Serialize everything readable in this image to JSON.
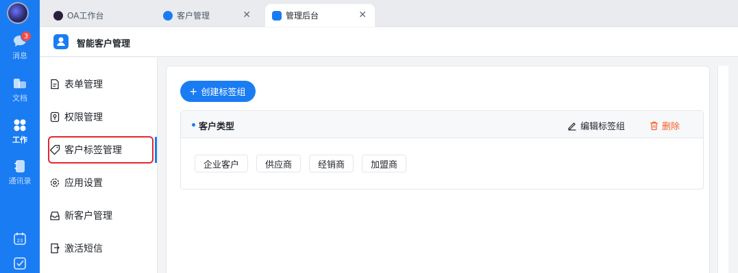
{
  "rail": {
    "items": [
      {
        "label": "消息",
        "icon": "chat-bubble-icon",
        "badge": "3"
      },
      {
        "label": "文档",
        "icon": "folder-icon"
      },
      {
        "label": "工作",
        "icon": "apps-grid-icon",
        "active": true
      },
      {
        "label": "通讯录",
        "icon": "contacts-book-icon"
      }
    ],
    "bottom_icons": [
      "calendar-icon",
      "todo-check-icon"
    ],
    "calendar_day": "23"
  },
  "tabs": [
    {
      "label": "OA工作台",
      "icon": "oa-logo-icon",
      "closable": false
    },
    {
      "label": "客户管理",
      "icon": "customer-app-icon",
      "closable": true
    },
    {
      "label": "管理后台",
      "icon": "admin-app-icon",
      "closable": true,
      "active": true
    }
  ],
  "app": {
    "title": "智能客户管理",
    "icon": "smart-customer-icon"
  },
  "menu": {
    "items": [
      {
        "label": "表单管理",
        "icon": "form-doc-icon"
      },
      {
        "label": "权限管理",
        "icon": "permission-key-icon"
      },
      {
        "label": "客户标签管理",
        "icon": "tag-icon",
        "selected": true
      },
      {
        "label": "应用设置",
        "icon": "settings-gear-icon"
      },
      {
        "label": "新客户管理",
        "icon": "inbox-tray-icon"
      },
      {
        "label": "激活短信",
        "icon": "sms-export-icon"
      }
    ]
  },
  "main": {
    "create_button": "创建标签组",
    "groups": [
      {
        "title": "客户类型",
        "edit_label": "编辑标签组",
        "delete_label": "删除",
        "tags": [
          "企业客户",
          "供应商",
          "经销商",
          "加盟商"
        ]
      }
    ]
  },
  "colors": {
    "primary": "#1a7cf3",
    "danger": "#f5602a",
    "highlight_border": "#e3262f"
  }
}
